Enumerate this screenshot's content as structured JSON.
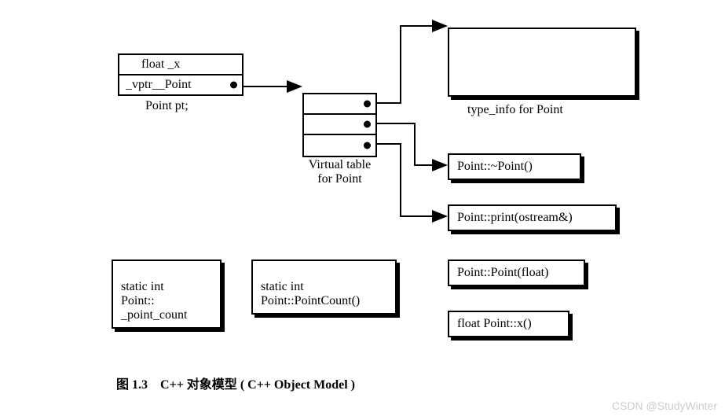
{
  "object": {
    "row1": "float _x",
    "row2": "_vptr__Point",
    "instance_label": "Point pt;"
  },
  "vtable": {
    "label": "Virtual table\nfor Point"
  },
  "typeinfo": {
    "label": "type_info for Point"
  },
  "vfuncs": {
    "dtor": "Point::~Point()",
    "print": "Point::print(ostream&)"
  },
  "statics": {
    "member": "static int\nPoint::\n_point_count",
    "func": "static int\nPoint::PointCount()"
  },
  "nonvirtual": {
    "ctor": "Point::Point(float)",
    "x": "float Point::x()"
  },
  "caption": {
    "num": "图 1.3",
    "zh": "C++ 对象模型",
    "en": "( C++ Object Model )"
  },
  "watermark": "CSDN @StudyWinter"
}
